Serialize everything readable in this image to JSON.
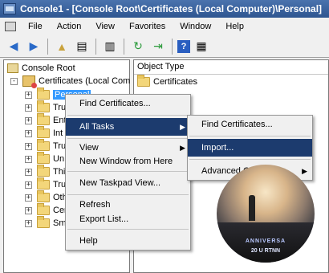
{
  "window": {
    "title": "Console1 - [Console Root\\Certificates (Local Computer)\\Personal]"
  },
  "menubar": {
    "items": [
      "File",
      "Action",
      "View",
      "Favorites",
      "Window",
      "Help"
    ]
  },
  "toolbar": {
    "buttons": [
      "back-arrow-icon",
      "forward-arrow-icon",
      "up-folder-icon",
      "show-hide-tree-icon",
      "properties-icon",
      "refresh-icon",
      "export-list-icon",
      "help-icon",
      "show-hide-action-pane-icon"
    ]
  },
  "tree": {
    "root": "Console Root",
    "certificates": "Certificates (Local Com",
    "items": [
      "Personal",
      "Tru",
      "Ent",
      "Int",
      "Tru",
      "Un",
      "Thi",
      "Tru",
      "Oth",
      "Cer",
      "Sm"
    ]
  },
  "right_pane": {
    "column_header": "Object Type",
    "rows": [
      "Certificates"
    ]
  },
  "context_menu": {
    "items": [
      "Find Certificates...",
      "All Tasks",
      "View",
      "New Window from Here",
      "New Taskpad View...",
      "Refresh",
      "Export List...",
      "Help"
    ]
  },
  "submenu": {
    "items": [
      "Find Certificates...",
      "Import...",
      "Advanced Operations"
    ]
  },
  "overlay": {
    "caption1": "ANNIVERSA",
    "caption2": "20 U RTNN"
  },
  "colors": {
    "highlight": "#1c3b6e",
    "selection": "#3399ff",
    "titlebar": "#2e5590"
  }
}
